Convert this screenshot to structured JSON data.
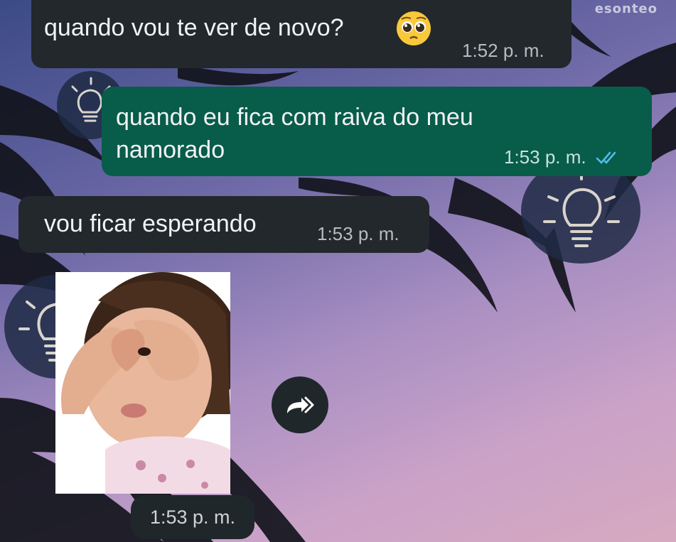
{
  "chat": {
    "watermark": "esonteo",
    "messages": [
      {
        "direction": "incoming",
        "text": "quando vou te ver de novo?",
        "emoji": "pleading-face",
        "time": "1:52 p. m."
      },
      {
        "direction": "outgoing",
        "text_line1": "quando eu fica com raiva do meu",
        "text_line2": "namorado",
        "time": "1:53 p. m.",
        "status": "read"
      },
      {
        "direction": "incoming",
        "text": "vou ficar esperando",
        "time": "1:53 p. m."
      },
      {
        "direction": "incoming",
        "type": "sticker",
        "sticker_subject": "child making heart with hands",
        "time": "1:53 p. m."
      }
    ]
  },
  "icons": {
    "forward": "forward-icon",
    "read_receipt": "double-check-icon",
    "wallpaper": "lightbulb-icon"
  },
  "colors": {
    "incoming_bubble": "#22282c",
    "outgoing_bubble": "#085c4a",
    "read_ticks": "#53bdeb",
    "background_top": "#3b4a86",
    "background_bottom": "#d7a9c0"
  }
}
